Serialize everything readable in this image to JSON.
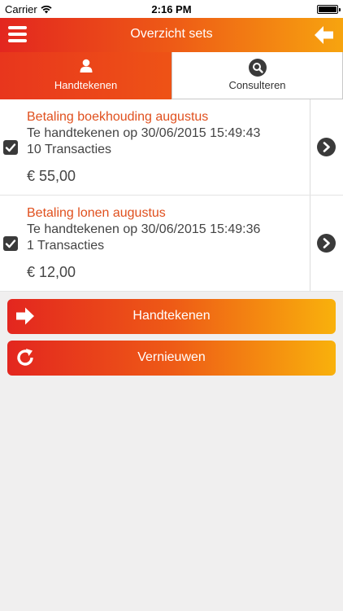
{
  "status_bar": {
    "carrier": "Carrier",
    "time": "2:16 PM"
  },
  "nav": {
    "title": "Overzicht sets"
  },
  "tabs": [
    {
      "label": "Handtekenen",
      "icon": "user-icon",
      "active": true
    },
    {
      "label": "Consulteren",
      "icon": "search-icon",
      "active": false
    }
  ],
  "sets": [
    {
      "title": "Betaling boekhouding augustus",
      "subtitle": "Te handtekenen op 30/06/2015 15:49:43",
      "transactions": "10 Transacties",
      "amount": "€ 55,00",
      "checked": true
    },
    {
      "title": "Betaling lonen augustus",
      "subtitle": "Te handtekenen op 30/06/2015 15:49:36",
      "transactions": "1 Transacties",
      "amount": "€ 12,00",
      "checked": true
    }
  ],
  "actions": {
    "sign_label": "Handtekenen",
    "refresh_label": "Vernieuwen"
  },
  "colors": {
    "gradient_start": "#e3261f",
    "gradient_mid": "#ee5a16",
    "gradient_end": "#f9b10c",
    "title_orange": "#e0501e",
    "background": "#f0efef"
  }
}
